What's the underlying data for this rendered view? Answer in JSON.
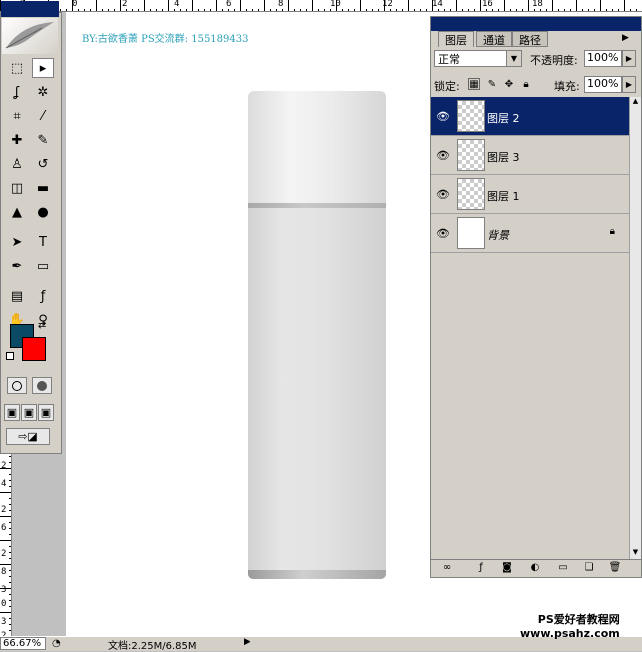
{
  "canvas": {
    "byline": "BY:古欲香萧 PS交流群: 155189433"
  },
  "rulers": {
    "top_numbers": [
      "2",
      "0",
      "2",
      "4",
      "6",
      "8",
      "10",
      "12",
      "14",
      "16",
      "18"
    ],
    "left_numbers": [
      "2",
      "4",
      "2",
      "6",
      "2",
      "8",
      "3",
      "0",
      "3",
      "2"
    ]
  },
  "toolbox": {
    "foreground_color": "#0a4a64",
    "background_color": "#ff0000",
    "tools": [
      {
        "name": "marquee-tool",
        "glyph": "⬚"
      },
      {
        "name": "move-tool",
        "glyph": "▸"
      },
      {
        "name": "lasso-tool",
        "glyph": "ʆ"
      },
      {
        "name": "magic-wand-tool",
        "glyph": "✲"
      },
      {
        "name": "crop-tool",
        "glyph": "⌗"
      },
      {
        "name": "slice-tool",
        "glyph": "⁄"
      },
      {
        "name": "healing-brush-tool",
        "glyph": "✚"
      },
      {
        "name": "brush-tool",
        "glyph": "✎"
      },
      {
        "name": "clone-stamp-tool",
        "glyph": "♙"
      },
      {
        "name": "history-brush-tool",
        "glyph": "↺"
      },
      {
        "name": "eraser-tool",
        "glyph": "◫"
      },
      {
        "name": "gradient-tool",
        "glyph": "▬"
      },
      {
        "name": "blur-tool",
        "glyph": "▲"
      },
      {
        "name": "dodge-tool",
        "glyph": "●"
      },
      {
        "name": "path-selection-tool",
        "glyph": "➤"
      },
      {
        "name": "type-tool",
        "glyph": "T"
      },
      {
        "name": "pen-tool",
        "glyph": "✒"
      },
      {
        "name": "shape-tool",
        "glyph": "▭"
      },
      {
        "name": "notes-tool",
        "glyph": "▤"
      },
      {
        "name": "eyedropper-tool",
        "glyph": "ƒ"
      },
      {
        "name": "hand-tool",
        "glyph": "✋"
      },
      {
        "name": "zoom-tool",
        "glyph": "⚲"
      }
    ]
  },
  "status_bar": {
    "zoom": "66.67%",
    "doc_info": "文档:2.25M/6.85M"
  },
  "watermark": {
    "line1": "PS爱好者教程网",
    "line2": "www.psahz.com"
  },
  "layers_panel": {
    "tabs": [
      "图层",
      "通道",
      "路径"
    ],
    "active_tab": "图层",
    "blend_mode": "正常",
    "opacity_label": "不透明度:",
    "opacity_value": "100%",
    "lock_label": "锁定:",
    "fill_label": "填充:",
    "fill_value": "100%",
    "layers": [
      {
        "name": "图层 2",
        "selected": true,
        "transparent": true,
        "locked": false
      },
      {
        "name": "图层 3",
        "selected": false,
        "transparent": true,
        "locked": false
      },
      {
        "name": "图层 1",
        "selected": false,
        "transparent": true,
        "locked": false
      },
      {
        "name": "背景",
        "selected": false,
        "transparent": false,
        "locked": true
      }
    ]
  }
}
